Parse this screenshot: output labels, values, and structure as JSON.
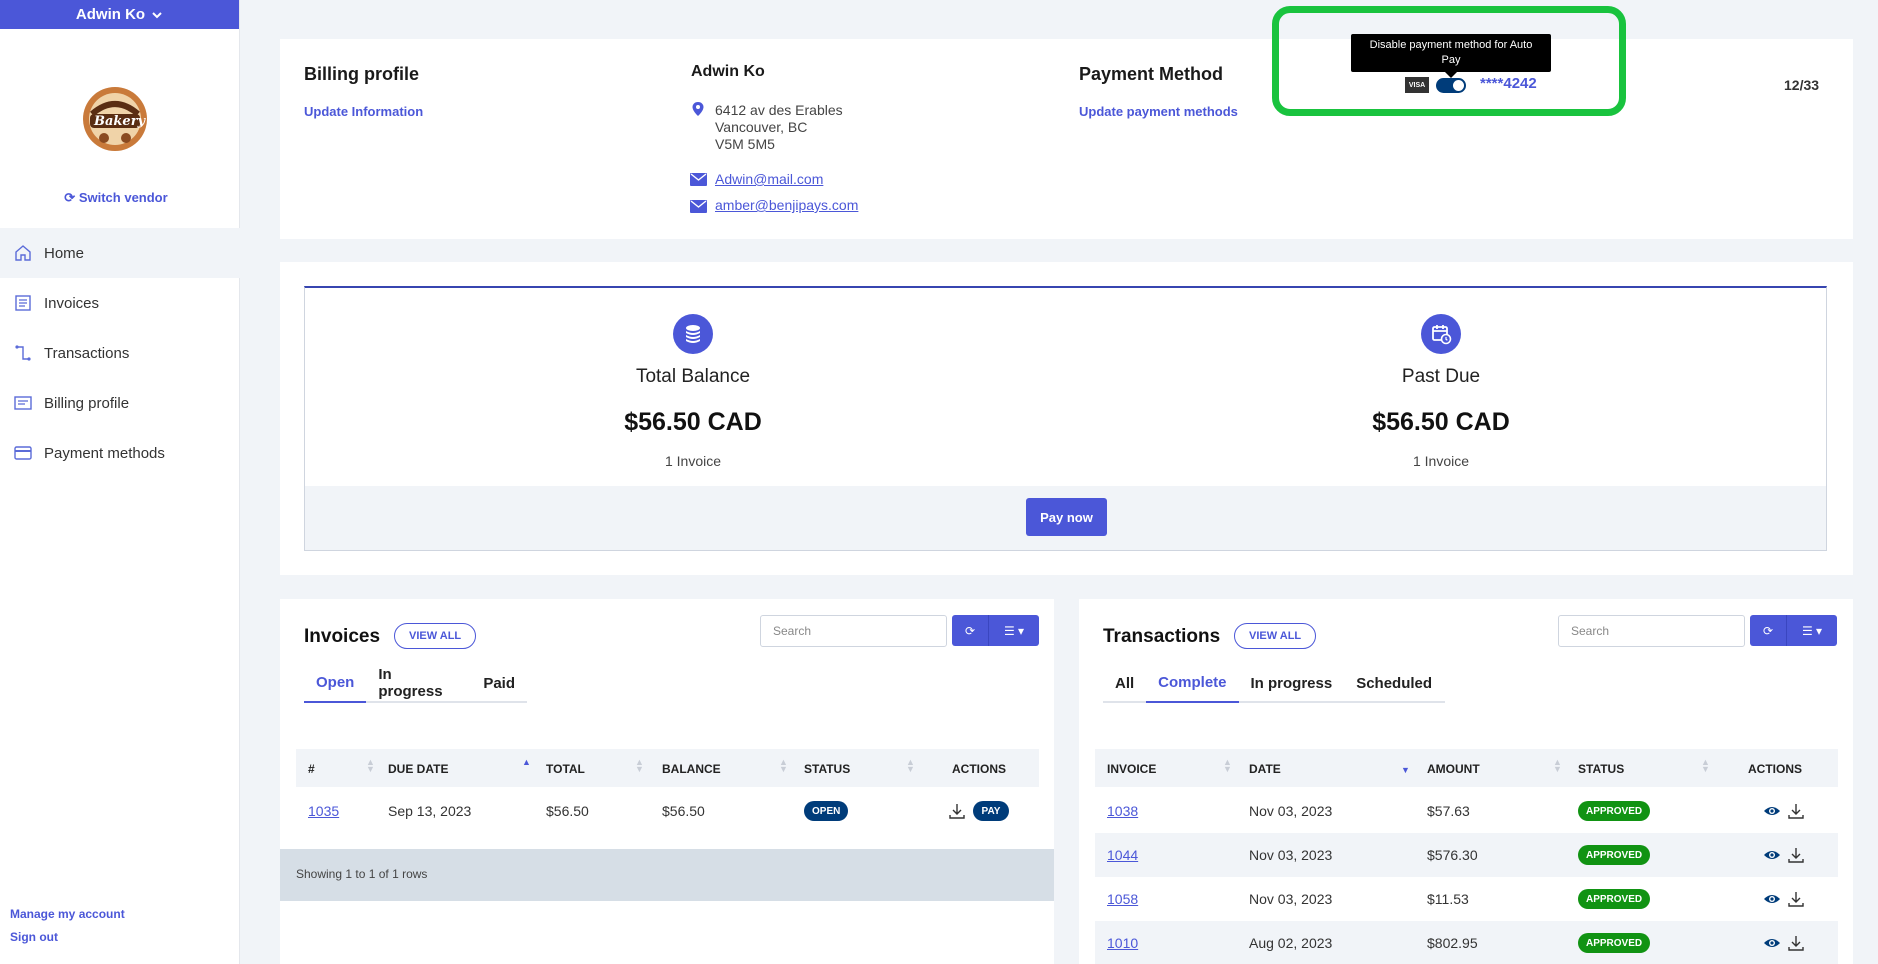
{
  "user": {
    "name": "Adwin Ko"
  },
  "sidebar": {
    "logo_text": "Bakery",
    "switch_vendor": "Switch vendor",
    "items": [
      {
        "label": "Home",
        "icon": "home-icon"
      },
      {
        "label": "Invoices",
        "icon": "invoice-icon"
      },
      {
        "label": "Transactions",
        "icon": "transactions-icon"
      },
      {
        "label": "Billing profile",
        "icon": "billing-icon"
      },
      {
        "label": "Payment methods",
        "icon": "card-icon"
      }
    ],
    "manage_account": "Manage my account",
    "sign_out": "Sign out"
  },
  "billing": {
    "title": "Billing profile",
    "update_info": "Update Information",
    "name": "Adwin Ko",
    "address_line1": "6412 av des Erables",
    "address_line2": "Vancouver, BC",
    "address_line3": "V5M 5M5",
    "email1": "Adwin@mail.com",
    "email2": "amber@benjipays.com"
  },
  "payment": {
    "title": "Payment Method",
    "update_link": "Update payment methods",
    "tooltip": "Disable payment method for Auto Pay",
    "brand": "VISA",
    "card_number": "****4242",
    "page_count": "12/33"
  },
  "summary": {
    "total_label": "Total Balance",
    "total_amount": "$56.50 CAD",
    "total_count": "1 Invoice",
    "past_label": "Past Due",
    "past_amount": "$56.50 CAD",
    "past_count": "1 Invoice",
    "pay_now": "Pay now"
  },
  "invoices": {
    "title": "Invoices",
    "view_all": "VIEW ALL",
    "search_placeholder": "Search",
    "tabs": [
      "Open",
      "In progress",
      "Paid"
    ],
    "columns": [
      "#",
      "DUE DATE",
      "TOTAL",
      "BALANCE",
      "STATUS",
      "ACTIONS"
    ],
    "rows": [
      {
        "num": "1035",
        "due": "Sep 13, 2023",
        "total": "$56.50",
        "balance": "$56.50",
        "status": "OPEN",
        "action": "PAY"
      }
    ],
    "footer": "Showing 1 to 1 of 1 rows"
  },
  "transactions": {
    "title": "Transactions",
    "view_all": "VIEW ALL",
    "search_placeholder": "Search",
    "tabs": [
      "All",
      "Complete",
      "In progress",
      "Scheduled"
    ],
    "columns": [
      "INVOICE",
      "DATE",
      "AMOUNT",
      "STATUS",
      "ACTIONS"
    ],
    "rows": [
      {
        "invoice": "1038",
        "date": "Nov 03, 2023",
        "amount": "$57.63",
        "status": "APPROVED"
      },
      {
        "invoice": "1044",
        "date": "Nov 03, 2023",
        "amount": "$576.30",
        "status": "APPROVED"
      },
      {
        "invoice": "1058",
        "date": "Nov 03, 2023",
        "amount": "$11.53",
        "status": "APPROVED"
      },
      {
        "invoice": "1010",
        "date": "Aug 02, 2023",
        "amount": "$802.95",
        "status": "APPROVED"
      }
    ]
  },
  "colors": {
    "accent": "#4b57d8",
    "navy": "#003c7a",
    "approved": "#119313",
    "highlight": "#19c33e"
  }
}
